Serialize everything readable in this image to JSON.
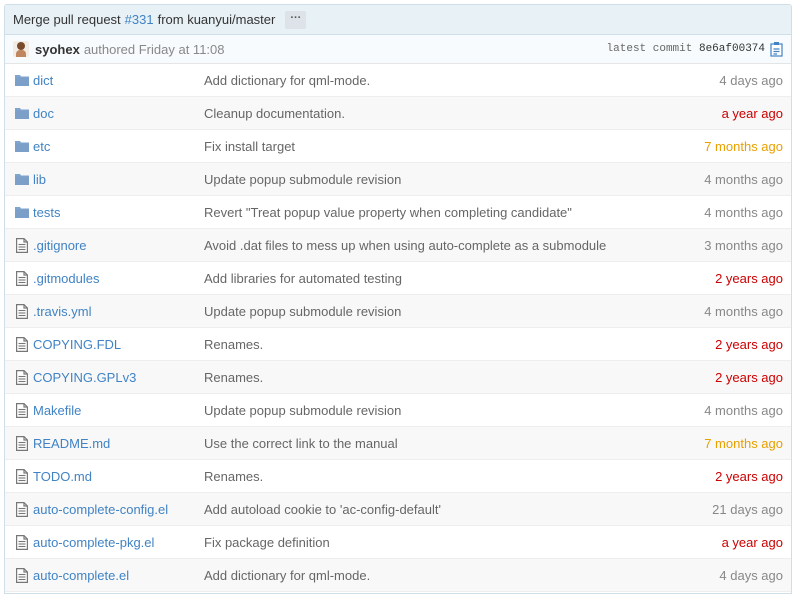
{
  "commit": {
    "title_prefix": "Merge pull request",
    "pr_ref": "#331",
    "title_suffix": "from kuanyui/master",
    "ellipsis": "···",
    "author": "syohex",
    "authored_text": "authored Friday at 11:08",
    "latest_label": "latest commit",
    "sha": "8e6af00374"
  },
  "colors": {
    "link": "#4183c4",
    "age_recent": "#888888",
    "age_mid": "#e8a000",
    "age_old": "#cc0000"
  },
  "files": [
    {
      "name": "dict",
      "type": "folder",
      "message": "Add dictionary for qml-mode.",
      "age": "4 days ago",
      "age_tone": "normal"
    },
    {
      "name": "doc",
      "type": "folder",
      "message": "Cleanup documentation.",
      "age": "a year ago",
      "age_tone": "red"
    },
    {
      "name": "etc",
      "type": "folder",
      "message": "Fix install target",
      "age": "7 months ago",
      "age_tone": "orange"
    },
    {
      "name": "lib",
      "type": "folder",
      "message": "Update popup submodule revision",
      "age": "4 months ago",
      "age_tone": "normal"
    },
    {
      "name": "tests",
      "type": "folder",
      "message": "Revert \"Treat popup value property when completing candidate\"",
      "age": "4 months ago",
      "age_tone": "normal"
    },
    {
      "name": ".gitignore",
      "type": "file",
      "message": "Avoid .dat files to mess up when using auto-complete as a submodule",
      "age": "3 months ago",
      "age_tone": "normal"
    },
    {
      "name": ".gitmodules",
      "type": "file",
      "message": "Add libraries for automated testing",
      "age": "2 years ago",
      "age_tone": "red"
    },
    {
      "name": ".travis.yml",
      "type": "file",
      "message": "Update popup submodule revision",
      "age": "4 months ago",
      "age_tone": "normal"
    },
    {
      "name": "COPYING.FDL",
      "type": "file",
      "message": "Renames.",
      "age": "2 years ago",
      "age_tone": "red"
    },
    {
      "name": "COPYING.GPLv3",
      "type": "file",
      "message": "Renames.",
      "age": "2 years ago",
      "age_tone": "red"
    },
    {
      "name": "Makefile",
      "type": "file",
      "message": "Update popup submodule revision",
      "age": "4 months ago",
      "age_tone": "normal"
    },
    {
      "name": "README.md",
      "type": "file",
      "message": "Use the correct link to the manual",
      "age": "7 months ago",
      "age_tone": "orange"
    },
    {
      "name": "TODO.md",
      "type": "file",
      "message": "Renames.",
      "age": "2 years ago",
      "age_tone": "red"
    },
    {
      "name": "auto-complete-config.el",
      "type": "file",
      "message": "Add autoload cookie to 'ac-config-default'",
      "age": "21 days ago",
      "age_tone": "normal"
    },
    {
      "name": "auto-complete-pkg.el",
      "type": "file",
      "message": "Fix package definition",
      "age": "a year ago",
      "age_tone": "red"
    },
    {
      "name": "auto-complete.el",
      "type": "file",
      "message": "Add dictionary for qml-mode.",
      "age": "4 days ago",
      "age_tone": "normal"
    }
  ]
}
